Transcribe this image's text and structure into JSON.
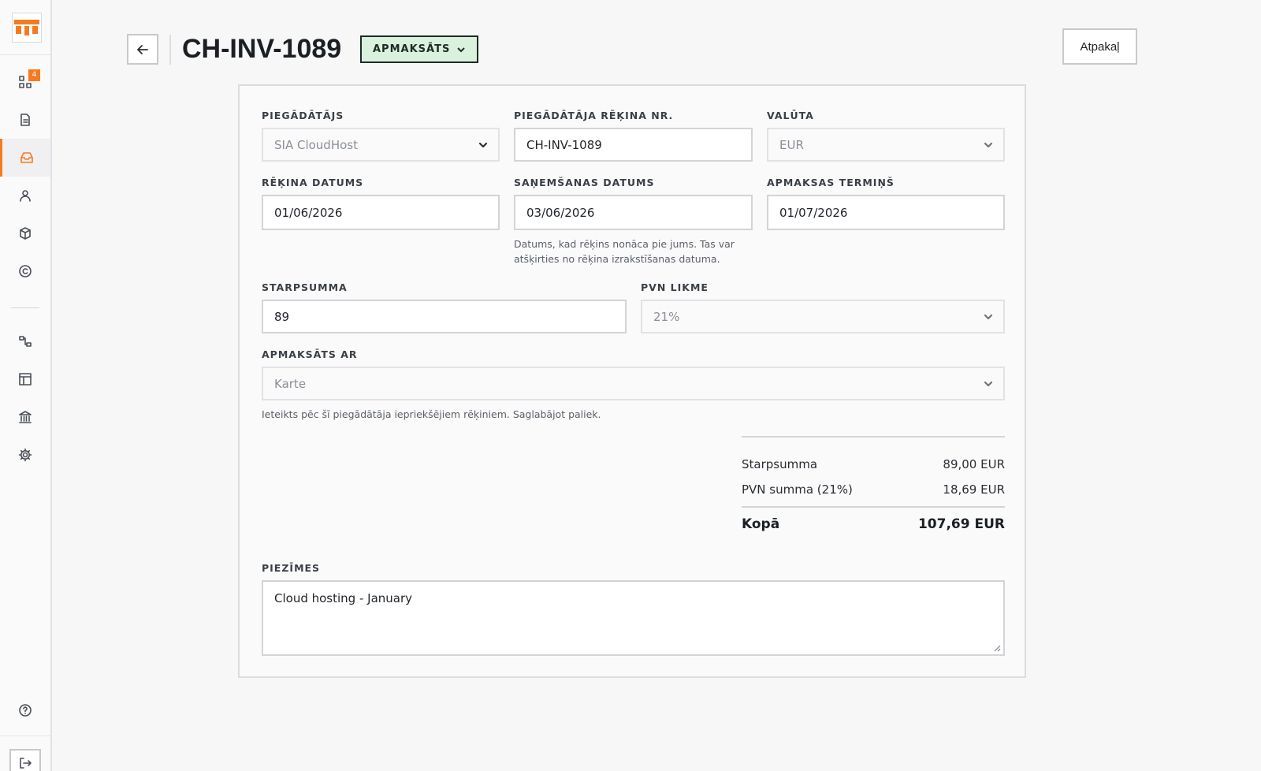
{
  "sidebar": {
    "logo": "app-logo",
    "items": [
      {
        "name": "dashboard",
        "icon": "grid-icon",
        "badge": "4"
      },
      {
        "name": "documents",
        "icon": "document-icon"
      },
      {
        "name": "inbox",
        "icon": "inbox-icon",
        "active": true
      },
      {
        "name": "contacts",
        "icon": "person-icon"
      },
      {
        "name": "products",
        "icon": "box-icon"
      },
      {
        "name": "copyright",
        "icon": "copyright-icon"
      },
      {
        "name": "integrations",
        "icon": "flow-icon"
      },
      {
        "name": "layout",
        "icon": "layout-icon"
      },
      {
        "name": "bank",
        "icon": "bank-icon"
      },
      {
        "name": "settings",
        "icon": "gear-icon"
      },
      {
        "name": "help",
        "icon": "help-icon"
      },
      {
        "name": "logout",
        "icon": "logout-icon"
      }
    ]
  },
  "header": {
    "title": "CH-INV-1089",
    "status": "APMAKSĀTS",
    "back_label": "Atpakaļ"
  },
  "form": {
    "supplier": {
      "label": "PIEGĀDĀTĀJS",
      "value": "SIA CloudHost"
    },
    "supplier_invoice_no": {
      "label": "PIEGĀDĀTĀJA RĒĶINA NR.",
      "value": "CH-INV-1089"
    },
    "currency": {
      "label": "VALŪTA",
      "value": "EUR"
    },
    "invoice_date": {
      "label": "RĒĶINA DATUMS",
      "value": "01/06/2026"
    },
    "received_date": {
      "label": "SAŅEMŠANAS DATUMS",
      "value": "03/06/2026",
      "hint_line1": "Datums, kad rēķins nonāca pie jums. Tas var",
      "hint_line2": "atšķirties no rēķina izrakstīšanas datuma."
    },
    "due_date": {
      "label": "APMAKSAS TERMIŅŠ",
      "value": "01/07/2026"
    },
    "subtotal": {
      "label": "STARPSUMMA",
      "value": "89"
    },
    "vat_rate": {
      "label": "PVN LIKME",
      "value": "21%"
    },
    "paid_with": {
      "label": "APMAKSĀTS AR",
      "value": "Karte",
      "hint": "Ieteikts pēc šī piegādātāja iepriekšējiem rēķiniem. Saglabājot paliek."
    },
    "notes": {
      "label": "PIEZĪMES",
      "value": "Cloud hosting - January"
    }
  },
  "totals": {
    "subtotal_label": "Starpsumma",
    "subtotal_value": "89,00 EUR",
    "vat_label": "PVN summa (21%)",
    "vat_value": "18,69 EUR",
    "total_label": "Kopā",
    "total_value": "107,69 EUR"
  },
  "colors": {
    "accent": "#f47b20",
    "status_bg": "#daf1de"
  }
}
